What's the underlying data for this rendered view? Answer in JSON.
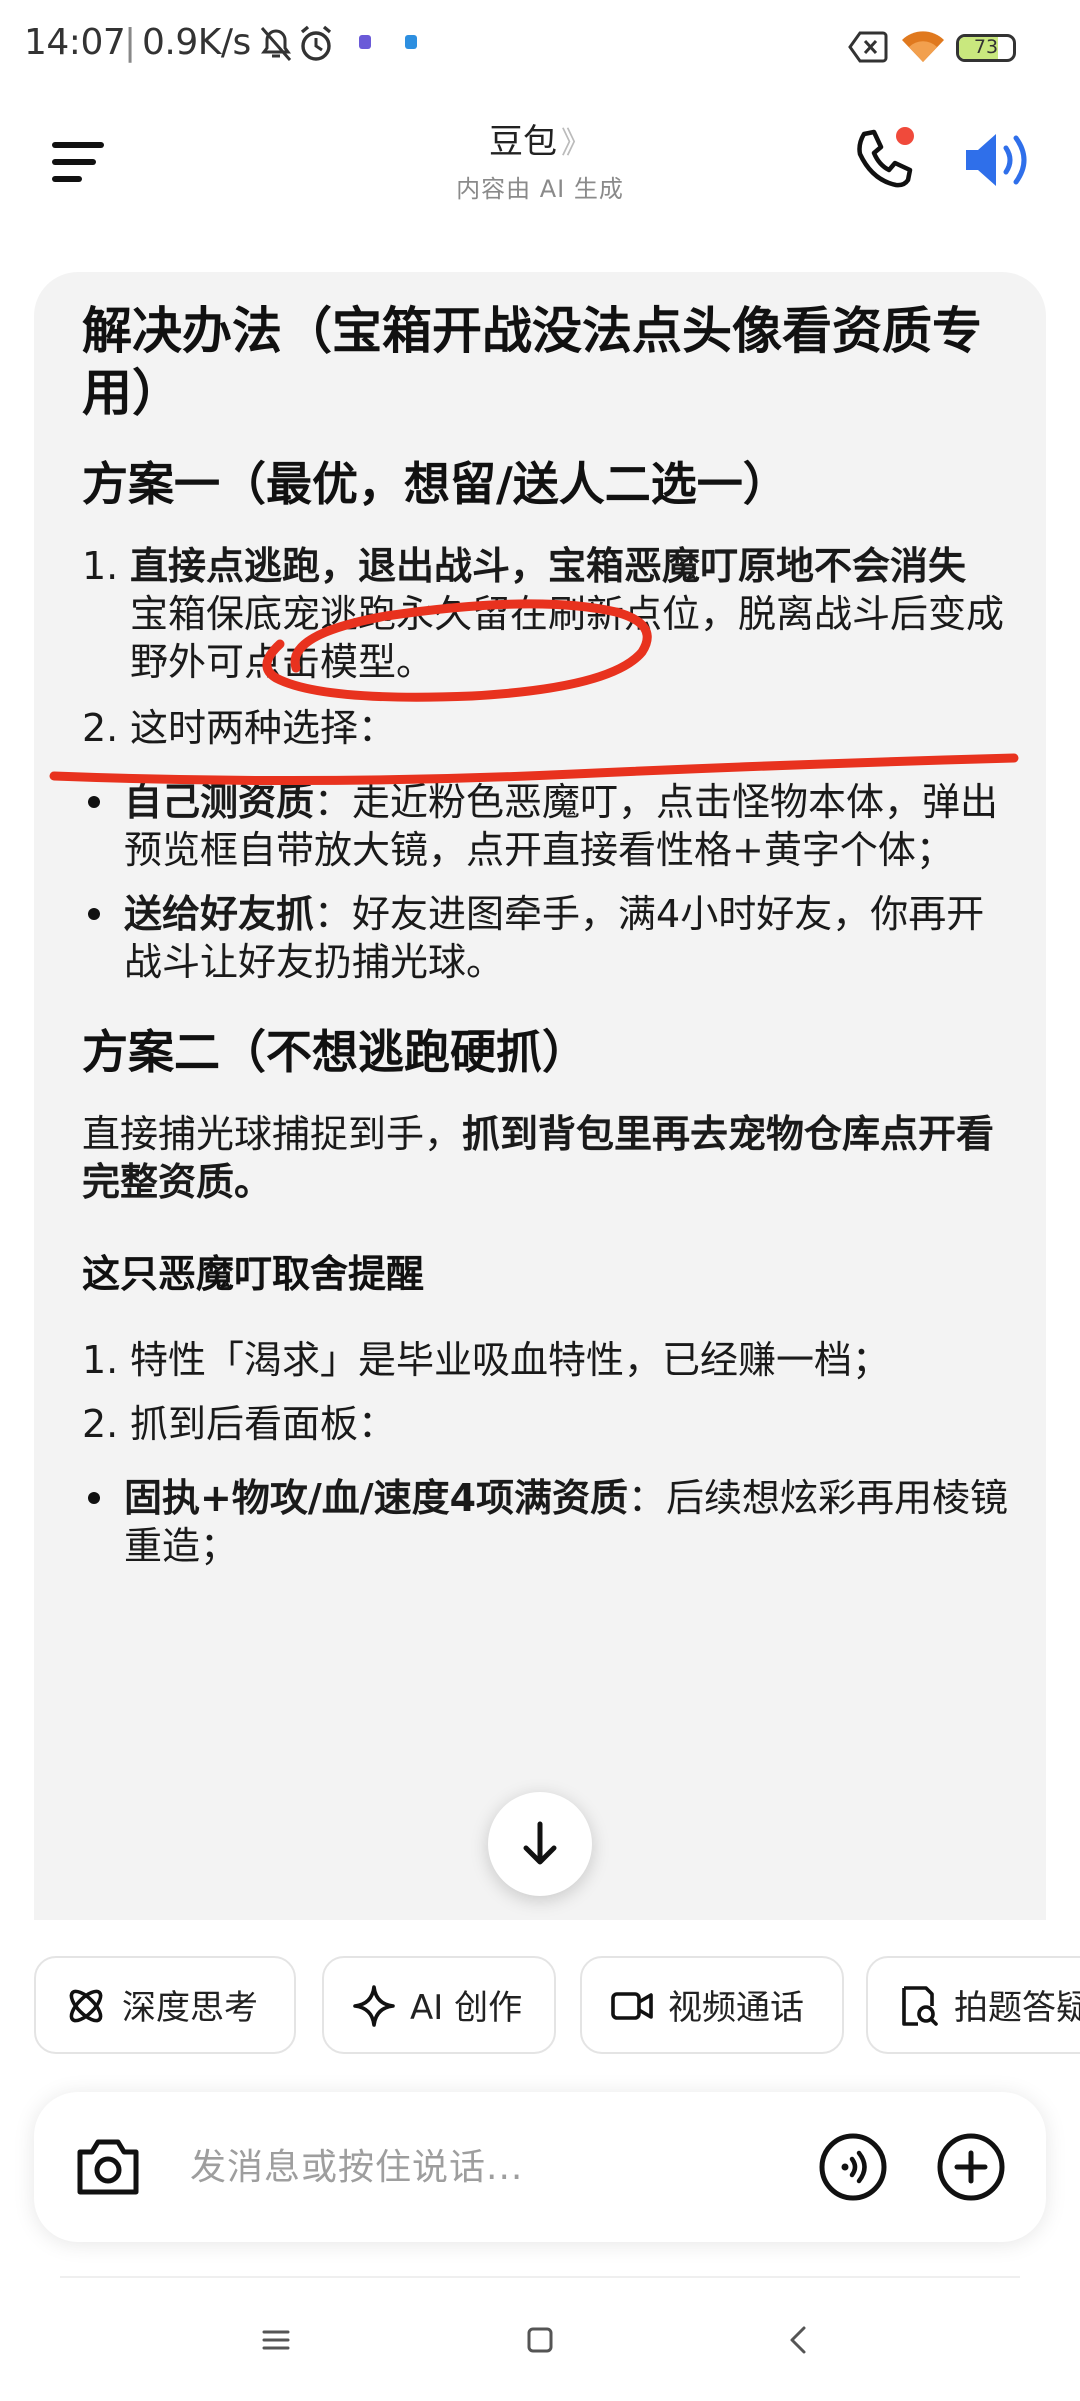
{
  "status_bar": {
    "time": "14:07",
    "net_speed": "0.9K/s",
    "battery": "73"
  },
  "header": {
    "title": "豆包",
    "title_chevron": "》",
    "subtitle": "内容由 AI 生成",
    "icons": [
      "menu-icon",
      "phone-icon",
      "speaker-icon"
    ],
    "accent_color": "#2f6fea",
    "notification_color": "#f04a3b"
  },
  "message": {
    "heading": "解决办法（宝箱开战没法点头像看资质专用）",
    "plan1": {
      "title": "方案一（最优，想留/送人二选一）",
      "item1_num": "1.",
      "item1_bold": "直接点逃跑，退出战斗，宝箱恶魔叮原地不会消失",
      "item1_text": "宝箱保底宠逃跑永久留在刷新点位，脱离战斗后变成野外可点击模型。",
      "item2_num": "2.",
      "item2_text": "这时两种选择：",
      "bullet1_bold": "自己测资质",
      "bullet1_text": "：走近粉色恶魔叮，点击怪物本体，弹出预览框自带放大镜，点开直接看性格+黄字个体；",
      "bullet2_bold": "送给好友抓",
      "bullet2_text": "：好友进图牵手，满4小时好友，你再开战斗让好友扔捕光球。"
    },
    "plan2": {
      "title": "方案二（不想逃跑硬抓）",
      "text": "直接捕光球捕捉到手，",
      "text_bold": "抓到背包里再去宠物仓库点开看完整资质。"
    },
    "reminder": {
      "title": "这只恶魔叮取舍提醒",
      "item1_num": "1.",
      "item1_text": "特性「渴求」是毕业吸血特性，已经赚一档；",
      "item2_num": "2.",
      "item2_text": "抓到后看面板：",
      "bullet1_bold": "固执+物攻/血/速度4项满资质",
      "bullet1_text": "：后续想炫彩再用棱镜重造；"
    },
    "annotation_color": "#e8321e"
  },
  "chips": [
    {
      "label": "深度思考",
      "icon": "atom-icon"
    },
    {
      "label": "AI 创作",
      "icon": "sparkle-icon"
    },
    {
      "label": "视频通话",
      "icon": "video-icon"
    },
    {
      "label": "拍题答疑",
      "icon": "photo-search-icon"
    }
  ],
  "input": {
    "placeholder": "发消息或按住说话..."
  }
}
